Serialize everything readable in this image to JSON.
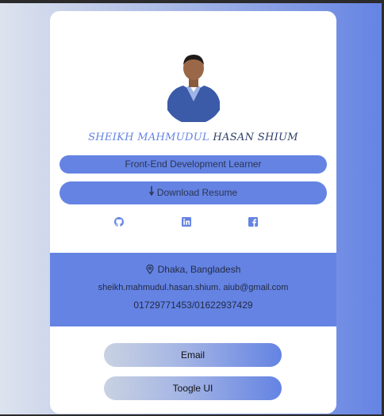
{
  "profile": {
    "name_first": "SHEIKH MAHMUDUL",
    "name_last": "HASAN SHIUM",
    "role": "Front-End Development Learner",
    "download_label": "Download Resume"
  },
  "social": {
    "icons": [
      "github-icon",
      "linkedin-icon",
      "facebook-icon"
    ]
  },
  "contact": {
    "location": "Dhaka, Bangladesh",
    "email": "sheikh.mahmudul.hasan.shium. aiub@gmail.com",
    "phone": "01729771453/01622937429"
  },
  "actions": {
    "email_label": "Email",
    "toggle_label": "Toogle UI"
  },
  "colors": {
    "accent": "#6483e3",
    "card": "#ffffff",
    "text_dark": "#2d3550"
  }
}
